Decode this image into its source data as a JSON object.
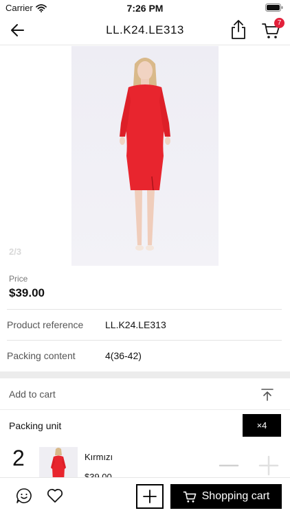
{
  "status_bar": {
    "carrier": "Carrier",
    "time": "7:26 PM",
    "wifi_icon": "wifi-icon",
    "battery_icon": "battery-icon"
  },
  "nav": {
    "title": "LL.K24.LE313",
    "back_icon": "arrow-left-icon",
    "share_icon": "share-icon",
    "cart_icon": "cart-icon",
    "cart_count": "7"
  },
  "gallery": {
    "counter": "2/3"
  },
  "price": {
    "label": "Price",
    "value": "$39.00"
  },
  "details": [
    {
      "key": "Product reference",
      "value": "LL.K24.LE313"
    },
    {
      "key": "Packing content",
      "value": "4(36-42)"
    }
  ],
  "add_to_cart": {
    "label": "Add to cart",
    "collapse_icon": "collapse-up-icon"
  },
  "packing_unit": {
    "label": "Packing unit",
    "button_label": "×4"
  },
  "variant": {
    "quantity": "2",
    "color_name": "Kırmızı",
    "price": "$39.00"
  },
  "bottom_bar": {
    "chat_icon": "chat-smile-icon",
    "favorite_icon": "heart-icon",
    "add_icon": "plus-icon",
    "shopping_cart_label": "Shopping cart"
  },
  "colors": {
    "accent": "#000000",
    "badge": "#e2203a",
    "dress": "#e8252e",
    "background": "#ffffff"
  }
}
